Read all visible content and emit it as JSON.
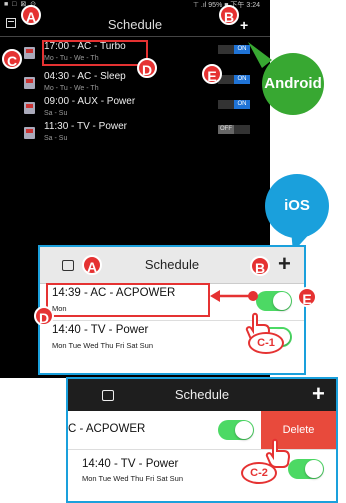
{
  "android": {
    "status_left": "■ □ ⊠ ⊙",
    "status_right": "⊤ .ıl 95% ■ 下午 3:24",
    "title": "Schedule",
    "add_label": "+",
    "schedules": [
      {
        "title": "17:00 - AC - Turbo",
        "days": "Mo - Tu - We - Th",
        "state": "ON"
      },
      {
        "title": "04:30 - AC - Sleep",
        "days": "Mo - Tu - We - Th",
        "state": "ON"
      },
      {
        "title": "09:00 - AUX - Power",
        "days": "Sa - Su",
        "state": "ON"
      },
      {
        "title": "11:30 - TV - Power",
        "days": "Sa - Su",
        "state": "OFF"
      }
    ]
  },
  "ios": {
    "title": "Schedule",
    "add_label": "+",
    "schedules": [
      {
        "title": "14:39 - AC - ACPOWER",
        "days": "Mon",
        "on": true
      },
      {
        "title": "14:40 - TV - Power",
        "days": "Mon Tue Wed Thu Fri Sat Sun",
        "on": true
      }
    ]
  },
  "ios_swipe": {
    "title": "Schedule",
    "add_label": "+",
    "swiped_row_title": "C - ACPOWER",
    "delete_label": "Delete",
    "row": {
      "title": "14:40 - TV - Power",
      "days": "Mon Tue Wed Thu Fri Sat Sun"
    }
  },
  "platform_labels": {
    "android": "Android",
    "ios": "iOS"
  },
  "markers": {
    "a": "A",
    "b": "B",
    "c": "C",
    "d": "D",
    "e": "E",
    "c1": "C-1",
    "c2": "C-2"
  },
  "colors": {
    "android_green": "#38a832",
    "ios_blue": "#1aa0dc",
    "marker_red": "#e53232",
    "toggle_green": "#4cd964",
    "delete_red": "#e84a3c",
    "android_switch_blue": "#1f73d6"
  }
}
